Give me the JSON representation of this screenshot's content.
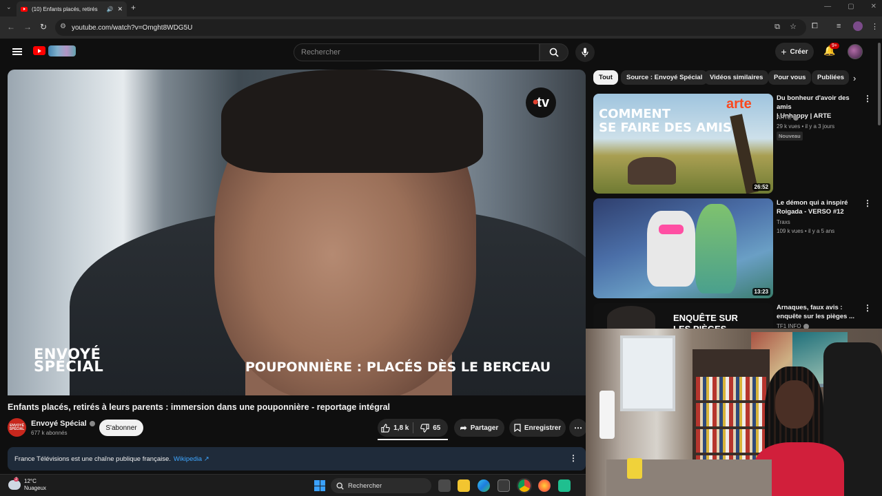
{
  "browser": {
    "tab_title": "(10) Enfants placés, retirés",
    "url": "youtube.com/watch?v=Omght8WDG5U"
  },
  "header": {
    "search_placeholder": "Rechercher",
    "create_label": "Créer",
    "notifications_badge": "9+"
  },
  "player": {
    "overlay_logo": "tv",
    "brand_line1": "ENVOYÉ",
    "brand_line2": "SPÉCIAL",
    "caption": "POUPONNIÈRE : PLACÉS DÈS LE BERCEAU"
  },
  "video": {
    "title": "Enfants placés, retirés à leurs parents : immersion dans une pouponnière - reportage intégral",
    "channel": "Envoyé Spécial",
    "subscribers": "677 k abonnés",
    "avatar_text": "ENVOYÉ SPÉCIAL",
    "subscribe_label": "S'abonner",
    "likes": "1,8 k",
    "dislikes": "65",
    "share_label": "Partager",
    "save_label": "Enregistrer"
  },
  "info_panel": {
    "text": "France Télévisions est une chaîne publique française.",
    "link": "Wikipedia ↗"
  },
  "chips": [
    "Tout",
    "Source : Envoyé Spécial",
    "Vidéos similaires",
    "Pour vous",
    "Publiées"
  ],
  "recommendations": [
    {
      "title_line1": "Du bonheur d'avoir des amis",
      "title_line2": "| Unhappy | ARTE",
      "channel": "ARTE",
      "meta": "29 k vues • il y a 3 jours",
      "badge": "Nouveau",
      "duration": "26:52",
      "thumb_text1": "COMMENT",
      "thumb_text2": "SE FAIRE DES AMIS ?",
      "thumb_brand": "arte"
    },
    {
      "title_line1": "Le démon qui a inspiré",
      "title_line2": "Roigada - VERSO #12",
      "channel": "Traxs",
      "meta": "109 k vues • il y a 5 ans",
      "duration": "13:23"
    },
    {
      "title_line1": "Arnaques, faux avis :",
      "title_line2": "enquête sur les pièges ...",
      "channel": "TF1 INFO",
      "thumb_text1": "ENQUÊTE SUR",
      "thumb_text2": "LES PIÈGES"
    }
  ],
  "taskbar": {
    "temp": "12°C",
    "weather": "Nuageux",
    "weather_badge": "2",
    "search_label": "Rechercher"
  }
}
